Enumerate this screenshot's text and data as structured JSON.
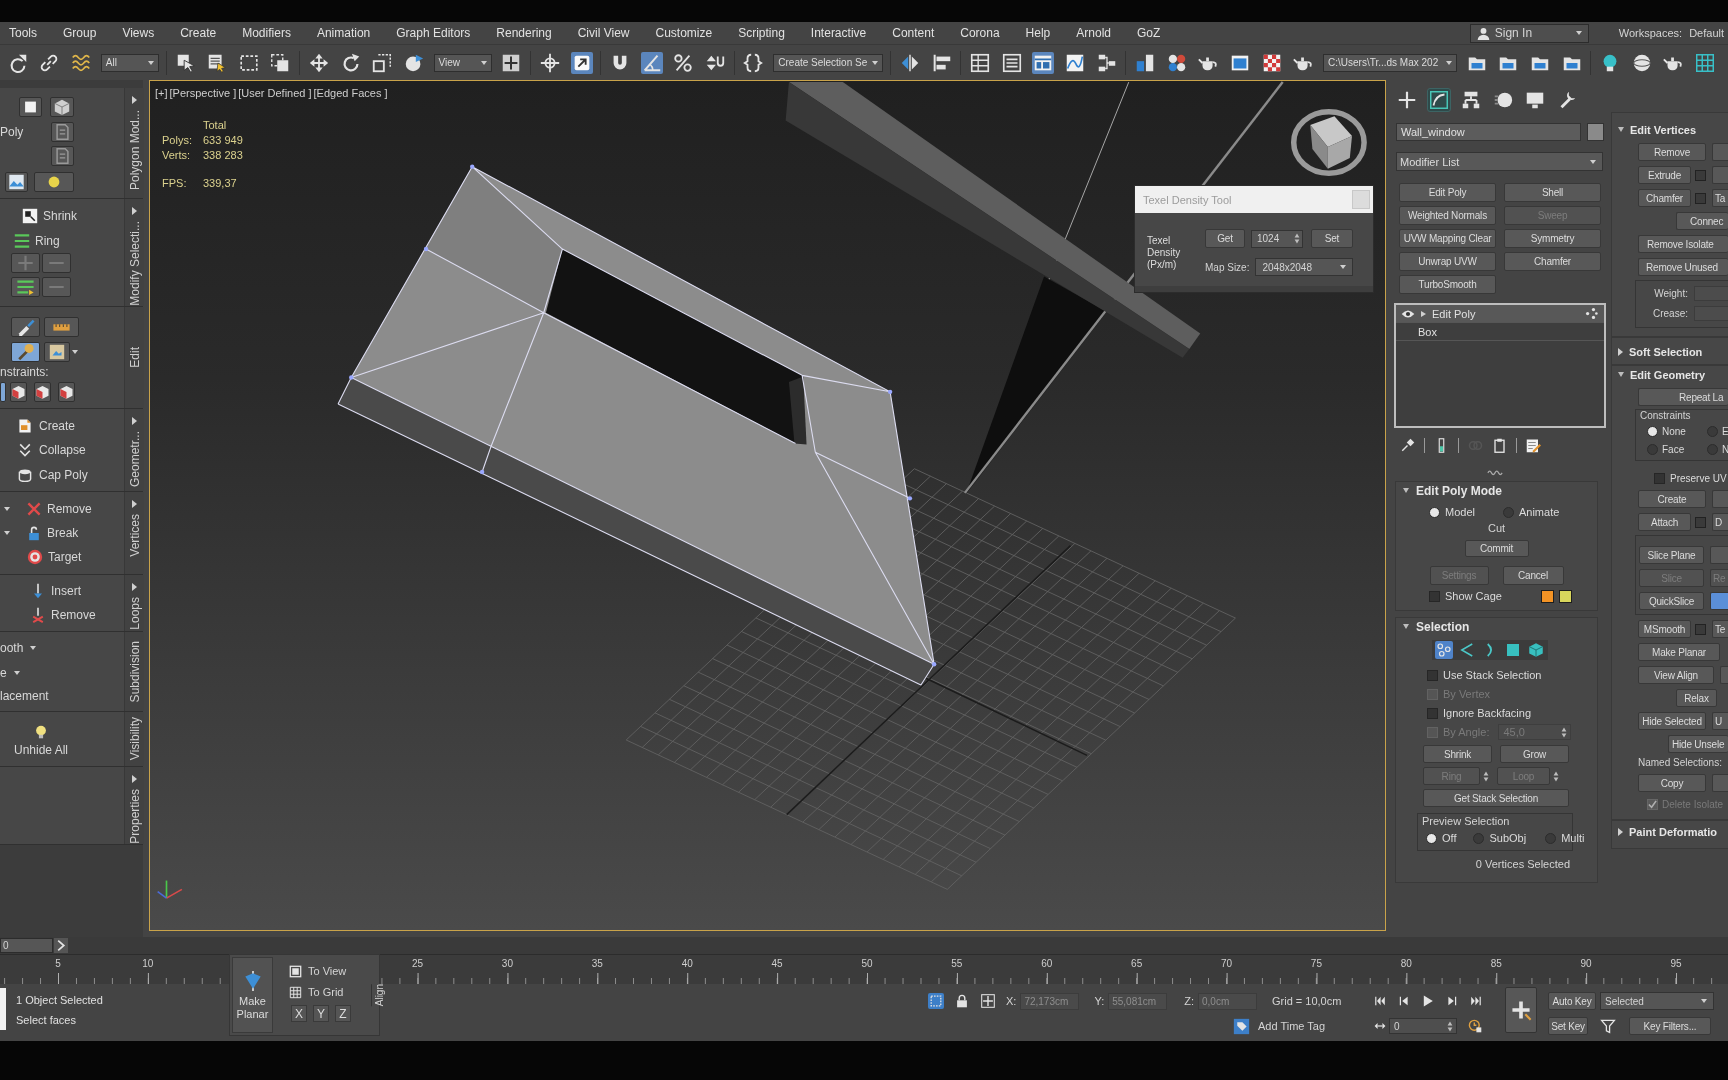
{
  "menu_bar": {
    "items": [
      "Tools",
      "Group",
      "Views",
      "Create",
      "Modifiers",
      "Animation",
      "Graph Editors",
      "Rendering",
      "Civil View",
      "Customize",
      "Scripting",
      "Interactive",
      "Content",
      "Corona",
      "Help",
      "Arnold",
      "GoZ"
    ],
    "sign_in": "Sign In",
    "workspaces_label": "Workspaces:",
    "workspace": "Default"
  },
  "main_toolbar": {
    "buttons": [
      {
        "active": false
      },
      {
        "active": false
      },
      {
        "active": false
      },
      {
        "active": false
      },
      {
        "active": false
      },
      {
        "active": false
      },
      {
        "active": false
      },
      {
        "active": false
      },
      {
        "active": false
      },
      {
        "active": false
      },
      {
        "active": false
      },
      {
        "active": false
      },
      {
        "active": false
      },
      {
        "active": true
      },
      {
        "active": false
      },
      {
        "active": true
      },
      {
        "active": false
      },
      {
        "active": false
      },
      {
        "active": false
      },
      {
        "active": false
      },
      {
        "active": false
      },
      {
        "active": false
      },
      {
        "active": false
      },
      {
        "active": true
      },
      {
        "active": false
      },
      {
        "active": false
      },
      {
        "active": false
      },
      {
        "active": false
      },
      {
        "active": false
      },
      {
        "active": false
      },
      {
        "active": false
      },
      {
        "active": false
      },
      {
        "active": false
      },
      {
        "active": false
      },
      {
        "active": false
      },
      {
        "active": false
      },
      {
        "active": false
      },
      {
        "active": false
      },
      {
        "active": false
      },
      {
        "active": false
      }
    ],
    "selection_filter": "All",
    "reference_coord": "View",
    "named_selection_set": "Create Selection Se",
    "project_folder": "C:\\Users\\Tr...ds Max 202"
  },
  "ribbon": {
    "sections": [
      {
        "label": "Polygon Mod...",
        "expandable": true,
        "text": "Poly"
      },
      {
        "label": "Modify Selecti...",
        "expandable": true,
        "items": [
          {
            "label": "Shrink"
          },
          {
            "label": "Ring"
          }
        ]
      },
      {
        "label": "Edit",
        "expandable": false,
        "tools": [
          {
            "active": false
          },
          {
            "active": false
          },
          {
            "active": true
          },
          {
            "active": false
          }
        ],
        "constraints_label": "nstraints:",
        "constraints": [
          {
            "active": true
          },
          {
            "active": false
          },
          {
            "active": false
          },
          {
            "active": false
          }
        ]
      },
      {
        "label": "Geometr...",
        "expandable": true,
        "items": [
          {
            "label": "Create"
          },
          {
            "label": "Collapse"
          },
          {
            "label": "Cap Poly"
          }
        ]
      },
      {
        "label": "Vertices",
        "expandable": true,
        "items": [
          {
            "label": "Remove",
            "dropdown": true
          },
          {
            "label": "Break",
            "dropdown": true
          },
          {
            "label": "Target",
            "dropdown": false
          }
        ]
      },
      {
        "label": "Loops",
        "expandable": true,
        "items": [
          {
            "label": "Insert"
          },
          {
            "label": "Remove"
          }
        ]
      },
      {
        "label": "Subdivision",
        "expandable": false,
        "items": [
          {
            "label": "ooth",
            "dropdown": true
          },
          {
            "label": "e",
            "dropdown": true
          },
          {
            "label": "lacement",
            "dropdown": false
          }
        ]
      },
      {
        "label": "Visibility",
        "expandable": false,
        "items": [
          {
            "label": "Unhide All"
          }
        ]
      },
      {
        "label": "Properties",
        "expandable": true
      }
    ]
  },
  "viewport": {
    "active": true,
    "labels": [
      "[+]",
      "[Perspective ]",
      "[User Defined ]",
      "[Edged Faces ]"
    ],
    "stats": {
      "heading": "Total",
      "rows": [
        {
          "label": "Polys:",
          "value": "633 949"
        },
        {
          "label": "Verts:",
          "value": "338 283"
        }
      ],
      "fps_label": "FPS:",
      "fps": "339,37"
    }
  },
  "texel_density_tool": {
    "title": "Texel Density Tool",
    "density_label": "Texel Density (Px/m)",
    "get": "Get",
    "density": "1024",
    "set": "Set",
    "map_size_label": "Map Size:",
    "map_size": "2048x2048"
  },
  "command_panel": {
    "tabs": [
      {
        "selected": false
      },
      {
        "selected": true
      },
      {
        "selected": false
      },
      {
        "selected": false
      },
      {
        "selected": false
      },
      {
        "selected": false
      }
    ],
    "object_name": "Wall_window",
    "modifier_list": "Modifier List",
    "modifier_buttons": [
      {
        "label": "Edit Poly",
        "disabled": false
      },
      {
        "label": "Shell",
        "disabled": false
      },
      {
        "label": "Weighted Normals",
        "disabled": false
      },
      {
        "label": "Sweep",
        "disabled": true
      },
      {
        "label": "UVW Mapping Clear",
        "disabled": false
      },
      {
        "label": "Symmetry",
        "disabled": false
      },
      {
        "label": "Unwrap UVW",
        "disabled": false
      },
      {
        "label": "Chamfer",
        "disabled": false
      },
      {
        "label": "TurboSmooth",
        "disabled": false
      }
    ],
    "stack": [
      {
        "kind": "modifier",
        "label": "Edit Poly",
        "selected": true
      },
      {
        "kind": "base",
        "label": "Box",
        "selected": false
      }
    ],
    "stack_tools": [
      {
        "disabled": false
      },
      {
        "disabled": false
      },
      {
        "disabled": true
      },
      {
        "disabled": false
      },
      {
        "disabled": false
      }
    ],
    "edit_poly_mode": {
      "title": "Edit Poly Mode",
      "expanded": true,
      "modes": [
        {
          "label": "Model",
          "selected": true
        },
        {
          "label": "Animate",
          "selected": false
        }
      ],
      "operation": "Cut",
      "commit": "Commit",
      "settings": {
        "label": "Settings",
        "disabled": true
      },
      "cancel": {
        "label": "Cancel",
        "disabled": false
      },
      "show_cage": {
        "label": "Show Cage",
        "checked": false
      },
      "cage_colors": [
        {
          "color": "#f39325"
        },
        {
          "color": "#d8d65c"
        }
      ]
    },
    "selection": {
      "title": "Selection",
      "expanded": true,
      "levels": [
        {
          "selected": true
        },
        {
          "selected": false
        },
        {
          "selected": false
        },
        {
          "selected": false
        },
        {
          "selected": false
        }
      ],
      "options": [
        {
          "label": "Use Stack Selection",
          "checked": false,
          "disabled": false
        },
        {
          "label": "By Vertex",
          "checked": false,
          "disabled": true
        },
        {
          "label": "Ignore Backfacing",
          "checked": false,
          "disabled": false
        }
      ],
      "by_angle": {
        "label": "By Angle:",
        "value": "45,0",
        "checked": false,
        "disabled": true
      },
      "shrink": "Shrink",
      "grow": "Grow",
      "ring": {
        "label": "Ring",
        "disabled": true
      },
      "loop": {
        "label": "Loop",
        "disabled": true
      },
      "get_stack_selection": "Get Stack Selection",
      "preview": {
        "label": "Preview Selection",
        "options": [
          {
            "label": "Off",
            "selected": true
          },
          {
            "label": "SubObj",
            "selected": false
          },
          {
            "label": "Multi",
            "selected": false
          }
        ]
      },
      "status": "0 Vertices Selected"
    },
    "edit_vertices": {
      "title": "Edit Vertices",
      "expanded": true,
      "remove": "Remove",
      "extrude": "Extrude",
      "chamfer": "Chamfer",
      "target_weld": "Ta",
      "connect": "Connec",
      "remove_isolated": "Remove Isolate",
      "remove_unused": "Remove Unused",
      "weight_label": "Weight:",
      "crease_label": "Crease:"
    },
    "soft_selection": {
      "title": "Soft Selection",
      "expanded": false
    },
    "edit_geometry": {
      "title": "Edit Geometry",
      "expanded": true,
      "repeat_last": "Repeat La",
      "constraints_label": "Constraints",
      "constraints": [
        {
          "label": "None",
          "selected": true
        },
        {
          "label": "E",
          "selected": false
        },
        {
          "label": "Face",
          "selected": false
        },
        {
          "label": "N",
          "selected": false
        }
      ],
      "preserve_uvs": {
        "label": "Preserve UV",
        "checked": false
      },
      "create": "Create",
      "attach": "Attach",
      "detach": "D",
      "slice_plane": "Slice Plane",
      "slice": {
        "label": "Slice",
        "disabled": true
      },
      "reset_plane": {
        "label": "Re",
        "disabled": true
      },
      "quickslice": "QuickSlice",
      "cut": {
        "selected": true
      },
      "msmooth": "MSmooth",
      "tessellate": "Te",
      "make_planar": "Make Planar",
      "view_align": "View Align",
      "relax": "Relax",
      "hide_selected": "Hide Selected",
      "unhide_all": "U",
      "hide_unselected": "Hide Unsele",
      "named_selections_label": "Named Selections:",
      "copy": "Copy",
      "delete_isolated": {
        "label": "Delete Isolate",
        "checked": true,
        "disabled": true
      }
    },
    "paint_deformation": {
      "title": "Paint Deformatio",
      "expanded": false
    }
  },
  "time_slider": {
    "label": "0",
    "level": 0
  },
  "timeline": {
    "labels_start": [
      "5",
      "10"
    ],
    "labels_end": [
      "25",
      "30",
      "35",
      "40",
      "45",
      "50",
      "55",
      "60",
      "65",
      "70",
      "75",
      "80",
      "85",
      "90",
      "95"
    ]
  },
  "align_toolbar": {
    "title": "Align",
    "make_planar": "Make Planar",
    "to_view": "To View",
    "to_grid": "To Grid",
    "axes": [
      "X",
      "Y",
      "Z"
    ]
  },
  "status_bar": {
    "selection_count": "1 Object Selected",
    "prompt": "Select faces",
    "selection_lock": true,
    "coords": [
      {
        "label": "X:",
        "value": "72,173cm",
        "disabled": true
      },
      {
        "label": "Y:",
        "value": "55,081cm",
        "disabled": true
      },
      {
        "label": "Z:",
        "value": "0,0cm",
        "disabled": true
      }
    ],
    "grid": "Grid = 10,0cm",
    "time_tag": "Add Time Tag",
    "frame": "0",
    "auto_key": {
      "label": "Auto Key",
      "on": false
    },
    "key_mode": "Selected",
    "set_key": "Set Key",
    "key_filters": "Key Filters..."
  }
}
